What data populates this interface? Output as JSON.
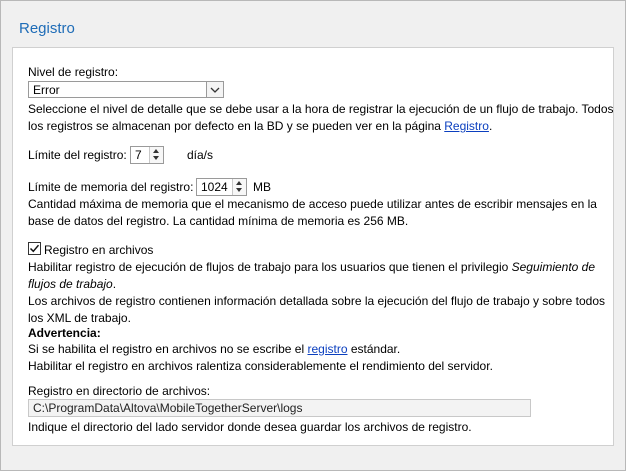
{
  "section": {
    "title": "Registro"
  },
  "log_level": {
    "label": "Nivel de registro:",
    "selected": "Error",
    "desc_line1": "Seleccione el nivel de detalle que se debe usar a la hora de registrar la ejecución de un flujo de trabajo. Todos",
    "desc_line2_before": "los registros se almacenan por defecto en la BD y se pueden ver en la página ",
    "desc_link": "Registro",
    "desc_line2_after": "."
  },
  "log_limit": {
    "label": "Límite del registro:",
    "value": "7",
    "unit": "día/s"
  },
  "memory_limit": {
    "label": "Límite de memoria del registro:",
    "value": "1024",
    "unit": "MB",
    "desc_line1": "Cantidad máxima de memoria que el mecanismo de acceso puede utilizar antes de escribir mensajes en la",
    "desc_line2": "base de datos del registro. La cantidad mínima de memoria es 256 MB."
  },
  "file_logging": {
    "checkbox_label": "Registro en archivos",
    "checked": true,
    "desc1_prefix": "Habilitar registro de ejecución de flujos de trabajo para los usuarios que tienen el privilegio ",
    "desc1_italic1": "Seguimiento de",
    "desc1_italic2": "flujos de trabajo",
    "desc1_suffix": ".",
    "desc2_line1": "Los archivos de registro contienen información detallada sobre la ejecución del flujo de trabajo y sobre todos",
    "desc2_line2": "los XML de trabajo.",
    "warning_title": "Advertencia:",
    "warning_line1_before": "Si se habilita el registro en archivos no se escribe el ",
    "warning_link": "registro",
    "warning_line1_after": " estándar.",
    "warning_line2": "Habilitar el registro en archivos ralentiza considerablemente el rendimiento del servidor."
  },
  "log_directory": {
    "label": "Registro en directorio de archivos:",
    "value": "C:\\ProgramData\\Altova\\MobileTogetherServer\\logs",
    "hint": "Indique el directorio del lado servidor donde desea guardar los archivos de registro."
  }
}
